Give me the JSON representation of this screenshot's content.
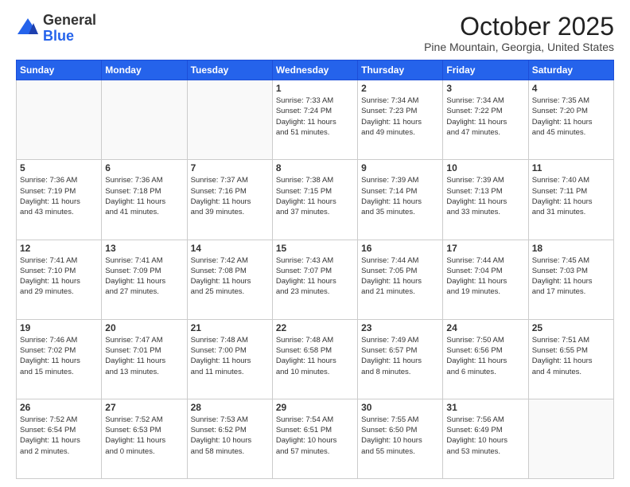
{
  "header": {
    "logo_general": "General",
    "logo_blue": "Blue",
    "month_title": "October 2025",
    "location": "Pine Mountain, Georgia, United States"
  },
  "weekdays": [
    "Sunday",
    "Monday",
    "Tuesday",
    "Wednesday",
    "Thursday",
    "Friday",
    "Saturday"
  ],
  "weeks": [
    [
      {
        "day": "",
        "info": ""
      },
      {
        "day": "",
        "info": ""
      },
      {
        "day": "",
        "info": ""
      },
      {
        "day": "1",
        "info": "Sunrise: 7:33 AM\nSunset: 7:24 PM\nDaylight: 11 hours\nand 51 minutes."
      },
      {
        "day": "2",
        "info": "Sunrise: 7:34 AM\nSunset: 7:23 PM\nDaylight: 11 hours\nand 49 minutes."
      },
      {
        "day": "3",
        "info": "Sunrise: 7:34 AM\nSunset: 7:22 PM\nDaylight: 11 hours\nand 47 minutes."
      },
      {
        "day": "4",
        "info": "Sunrise: 7:35 AM\nSunset: 7:20 PM\nDaylight: 11 hours\nand 45 minutes."
      }
    ],
    [
      {
        "day": "5",
        "info": "Sunrise: 7:36 AM\nSunset: 7:19 PM\nDaylight: 11 hours\nand 43 minutes."
      },
      {
        "day": "6",
        "info": "Sunrise: 7:36 AM\nSunset: 7:18 PM\nDaylight: 11 hours\nand 41 minutes."
      },
      {
        "day": "7",
        "info": "Sunrise: 7:37 AM\nSunset: 7:16 PM\nDaylight: 11 hours\nand 39 minutes."
      },
      {
        "day": "8",
        "info": "Sunrise: 7:38 AM\nSunset: 7:15 PM\nDaylight: 11 hours\nand 37 minutes."
      },
      {
        "day": "9",
        "info": "Sunrise: 7:39 AM\nSunset: 7:14 PM\nDaylight: 11 hours\nand 35 minutes."
      },
      {
        "day": "10",
        "info": "Sunrise: 7:39 AM\nSunset: 7:13 PM\nDaylight: 11 hours\nand 33 minutes."
      },
      {
        "day": "11",
        "info": "Sunrise: 7:40 AM\nSunset: 7:11 PM\nDaylight: 11 hours\nand 31 minutes."
      }
    ],
    [
      {
        "day": "12",
        "info": "Sunrise: 7:41 AM\nSunset: 7:10 PM\nDaylight: 11 hours\nand 29 minutes."
      },
      {
        "day": "13",
        "info": "Sunrise: 7:41 AM\nSunset: 7:09 PM\nDaylight: 11 hours\nand 27 minutes."
      },
      {
        "day": "14",
        "info": "Sunrise: 7:42 AM\nSunset: 7:08 PM\nDaylight: 11 hours\nand 25 minutes."
      },
      {
        "day": "15",
        "info": "Sunrise: 7:43 AM\nSunset: 7:07 PM\nDaylight: 11 hours\nand 23 minutes."
      },
      {
        "day": "16",
        "info": "Sunrise: 7:44 AM\nSunset: 7:05 PM\nDaylight: 11 hours\nand 21 minutes."
      },
      {
        "day": "17",
        "info": "Sunrise: 7:44 AM\nSunset: 7:04 PM\nDaylight: 11 hours\nand 19 minutes."
      },
      {
        "day": "18",
        "info": "Sunrise: 7:45 AM\nSunset: 7:03 PM\nDaylight: 11 hours\nand 17 minutes."
      }
    ],
    [
      {
        "day": "19",
        "info": "Sunrise: 7:46 AM\nSunset: 7:02 PM\nDaylight: 11 hours\nand 15 minutes."
      },
      {
        "day": "20",
        "info": "Sunrise: 7:47 AM\nSunset: 7:01 PM\nDaylight: 11 hours\nand 13 minutes."
      },
      {
        "day": "21",
        "info": "Sunrise: 7:48 AM\nSunset: 7:00 PM\nDaylight: 11 hours\nand 11 minutes."
      },
      {
        "day": "22",
        "info": "Sunrise: 7:48 AM\nSunset: 6:58 PM\nDaylight: 11 hours\nand 10 minutes."
      },
      {
        "day": "23",
        "info": "Sunrise: 7:49 AM\nSunset: 6:57 PM\nDaylight: 11 hours\nand 8 minutes."
      },
      {
        "day": "24",
        "info": "Sunrise: 7:50 AM\nSunset: 6:56 PM\nDaylight: 11 hours\nand 6 minutes."
      },
      {
        "day": "25",
        "info": "Sunrise: 7:51 AM\nSunset: 6:55 PM\nDaylight: 11 hours\nand 4 minutes."
      }
    ],
    [
      {
        "day": "26",
        "info": "Sunrise: 7:52 AM\nSunset: 6:54 PM\nDaylight: 11 hours\nand 2 minutes."
      },
      {
        "day": "27",
        "info": "Sunrise: 7:52 AM\nSunset: 6:53 PM\nDaylight: 11 hours\nand 0 minutes."
      },
      {
        "day": "28",
        "info": "Sunrise: 7:53 AM\nSunset: 6:52 PM\nDaylight: 10 hours\nand 58 minutes."
      },
      {
        "day": "29",
        "info": "Sunrise: 7:54 AM\nSunset: 6:51 PM\nDaylight: 10 hours\nand 57 minutes."
      },
      {
        "day": "30",
        "info": "Sunrise: 7:55 AM\nSunset: 6:50 PM\nDaylight: 10 hours\nand 55 minutes."
      },
      {
        "day": "31",
        "info": "Sunrise: 7:56 AM\nSunset: 6:49 PM\nDaylight: 10 hours\nand 53 minutes."
      },
      {
        "day": "",
        "info": ""
      }
    ]
  ]
}
